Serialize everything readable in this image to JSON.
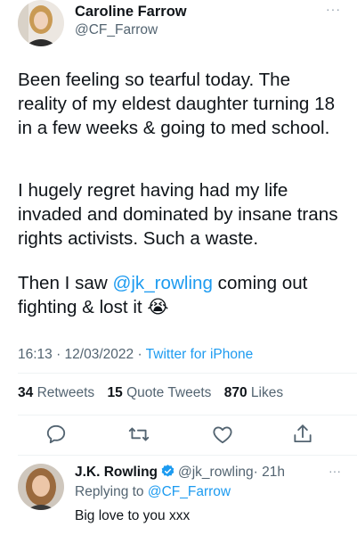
{
  "tweet": {
    "author": {
      "name": "Caroline Farrow",
      "handle": "@CF_Farrow"
    },
    "more_label": "···",
    "paragraph1": "Been feeling so tearful today. The reality of my eldest daughter turning 18 in a few weeks & going to med school.",
    "paragraph2": "I hugely regret having had my life invaded and dominated by insane trans rights activists. Such a waste.",
    "paragraph3_before": "Then I saw ",
    "paragraph3_mention": "@jk_rowling",
    "paragraph3_after": " coming out fighting & lost it ",
    "paragraph3_emoji": "😭",
    "time": "16:13 · 12/03/2022",
    "sep": " · ",
    "source": "Twitter for iPhone",
    "stats": {
      "retweets_count": "34",
      "retweets_label": "Retweets",
      "quotes_count": "15",
      "quotes_label": "Quote Tweets",
      "likes_count": "870",
      "likes_label": "Likes"
    },
    "actions": [
      "reply-icon",
      "retweet-icon",
      "like-icon",
      "share-icon"
    ]
  },
  "reply": {
    "author": {
      "name": "J.K. Rowling",
      "handle": "@jk_rowling",
      "age": "· 21h"
    },
    "replying_prefix": "Replying to ",
    "replying_to": "@CF_Farrow",
    "text": "Big love to you xxx",
    "more_label": "···"
  },
  "colors": {
    "accent": "#1d9bf0",
    "muted": "#536471",
    "text": "#0f1419",
    "divider": "#eff3f4"
  }
}
